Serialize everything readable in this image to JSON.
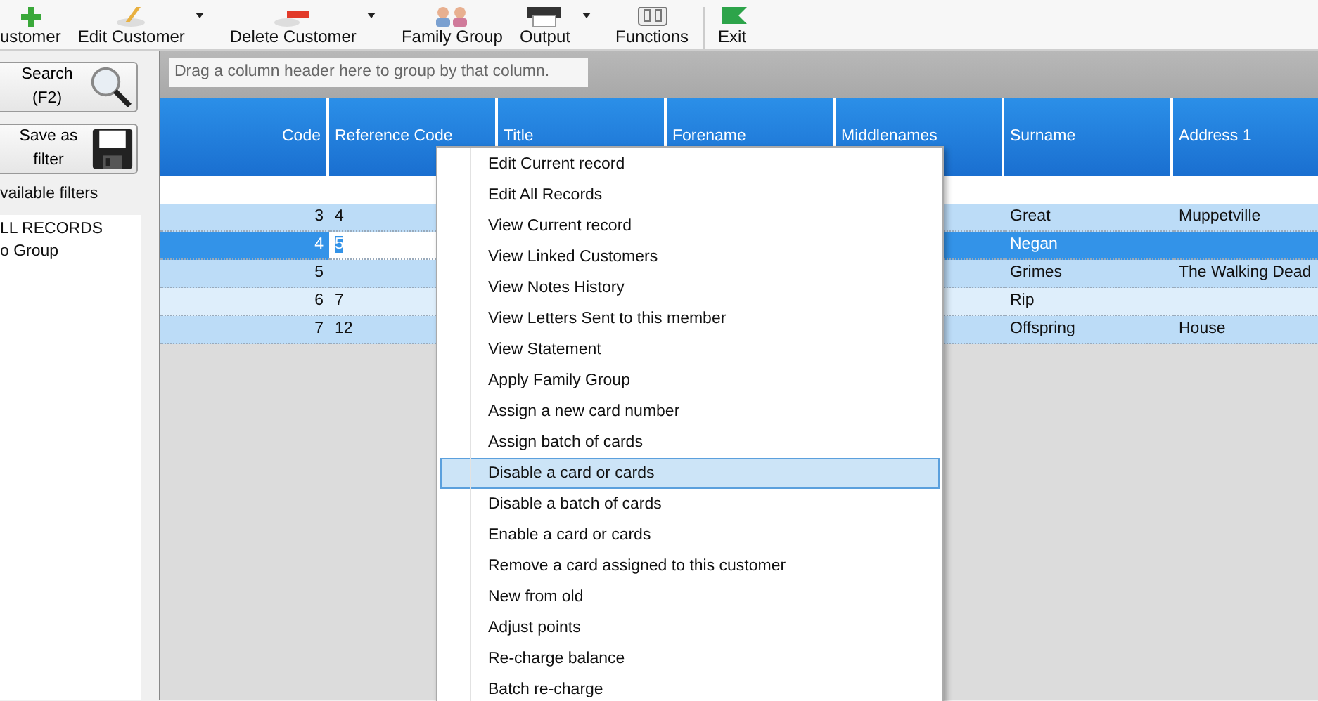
{
  "toolbar": [
    {
      "label": "ustomer",
      "dropdown": false
    },
    {
      "label": "Edit Customer",
      "dropdown": true
    },
    {
      "label": "Delete Customer",
      "dropdown": true
    },
    {
      "label": "Family Group",
      "dropdown": false
    },
    {
      "label": "Output",
      "dropdown": true
    },
    {
      "label": "Functions",
      "dropdown": false
    },
    {
      "label": "Exit",
      "dropdown": false
    }
  ],
  "sidebar": {
    "buttons": [
      {
        "label": "Search (F2)"
      },
      {
        "label": "Save as filter"
      }
    ],
    "filters_label": "vailable filters",
    "filters": [
      "LL RECORDS",
      "o Group"
    ]
  },
  "grid": {
    "group_hint": "Drag a column header here to group by that column.",
    "columns": [
      "Code",
      "Reference Code",
      "Title",
      "Forename",
      "Middlenames",
      "Surname",
      "Address 1"
    ],
    "rows": [
      {
        "selected": false,
        "cells": [
          "3",
          "4",
          "",
          "",
          "",
          "Great",
          "Muppetville"
        ]
      },
      {
        "selected": true,
        "editing_value": "5",
        "cells": [
          "4",
          "",
          "",
          "",
          "",
          "Negan",
          ""
        ]
      },
      {
        "selected": false,
        "cells": [
          "5",
          "",
          "",
          "",
          "",
          "Grimes",
          "The Walking Dead"
        ]
      },
      {
        "selected": false,
        "cells": [
          "6",
          "7",
          "",
          "",
          "",
          "Rip",
          ""
        ]
      },
      {
        "selected": false,
        "cells": [
          "7",
          "12",
          "",
          "",
          "",
          "Offspring",
          "House"
        ]
      }
    ]
  },
  "context_menu": [
    {
      "label": "Edit Current record",
      "selected": false
    },
    {
      "label": "Edit All Records",
      "selected": false
    },
    {
      "label": "View Current record",
      "selected": false
    },
    {
      "label": "View Linked Customers",
      "selected": false
    },
    {
      "label": "View Notes History",
      "selected": false
    },
    {
      "label": "View Letters Sent to this member",
      "selected": false
    },
    {
      "label": "View Statement",
      "selected": false
    },
    {
      "label": "Apply Family Group",
      "selected": false
    },
    {
      "label": "Assign a new card number",
      "selected": false
    },
    {
      "label": "Assign batch of cards",
      "selected": false
    },
    {
      "label": "Disable a card or cards",
      "selected": true
    },
    {
      "label": "Disable a batch of cards",
      "selected": false
    },
    {
      "label": "Enable  a card or cards",
      "selected": false
    },
    {
      "label": "Remove a card assigned to this customer",
      "selected": false
    },
    {
      "label": "New from old",
      "selected": false
    },
    {
      "label": "Adjust points",
      "selected": false
    },
    {
      "label": "Re-charge balance",
      "selected": false
    },
    {
      "label": "Batch re-charge",
      "selected": false
    }
  ]
}
